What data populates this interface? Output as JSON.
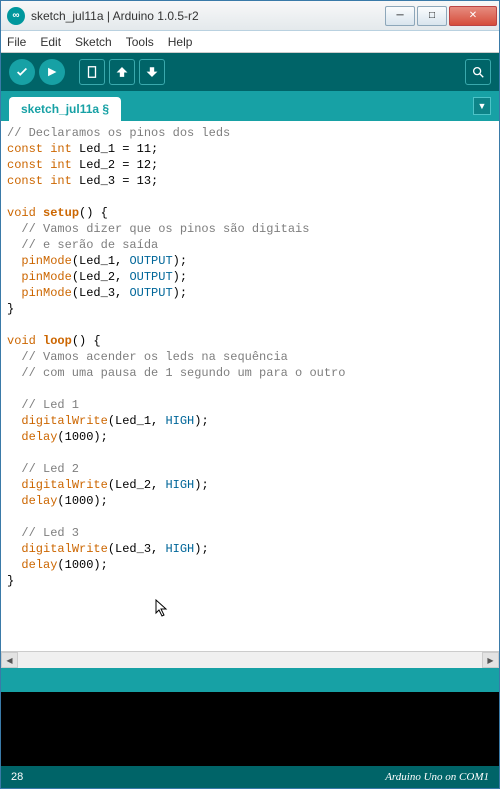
{
  "window": {
    "title": "sketch_jul11a | Arduino 1.0.5-r2",
    "logo": "∞"
  },
  "menu": {
    "file": "File",
    "edit": "Edit",
    "sketch": "Sketch",
    "tools": "Tools",
    "help": "Help"
  },
  "tab": {
    "name": "sketch_jul11a §"
  },
  "status": {
    "line": "28",
    "board": "Arduino Uno on COM1"
  },
  "code": {
    "c1": "// Declaramos os pinos dos leds",
    "l2a": "const",
    "l2b": " int",
    "l2c": " Led_1 = 11;",
    "l3a": "const",
    "l3b": " int",
    "l3c": " Led_2 = 12;",
    "l4a": "const",
    "l4b": " int",
    "l4c": " Led_3 = 13;",
    "l6a": "void",
    "l6b": " ",
    "l6c": "setup",
    "l6d": "() {",
    "c7": "  // Vamos dizer que os pinos são digitais",
    "c8": "  // e serão de saída",
    "l9a": "  ",
    "l9b": "pinMode",
    "l9c": "(Led_1, ",
    "l9d": "OUTPUT",
    "l9e": ");",
    "l10a": "  ",
    "l10b": "pinMode",
    "l10c": "(Led_2, ",
    "l10d": "OUTPUT",
    "l10e": ");",
    "l11a": "  ",
    "l11b": "pinMode",
    "l11c": "(Led_3, ",
    "l11d": "OUTPUT",
    "l11e": ");",
    "l12": "}",
    "l14a": "void",
    "l14b": " ",
    "l14c": "loop",
    "l14d": "() {",
    "c15": "  // Vamos acender os leds na sequência",
    "c16": "  // com uma pausa de 1 segundo um para o outro",
    "c18": "  // Led 1",
    "l19a": "  ",
    "l19b": "digitalWrite",
    "l19c": "(Led_1, ",
    "l19d": "HIGH",
    "l19e": ");",
    "l20a": "  ",
    "l20b": "delay",
    "l20c": "(1000);",
    "c22": "  // Led 2",
    "l23a": "  ",
    "l23b": "digitalWrite",
    "l23c": "(Led_2, ",
    "l23d": "HIGH",
    "l23e": ");",
    "l24a": "  ",
    "l24b": "delay",
    "l24c": "(1000);",
    "c26": "  // Led 3",
    "l27a": "  ",
    "l27b": "digitalWrite",
    "l27c": "(Led_3, ",
    "l27d": "HIGH",
    "l27e": ");",
    "l28a": "  ",
    "l28b": "delay",
    "l28c": "(1000);",
    "l29": "}"
  }
}
